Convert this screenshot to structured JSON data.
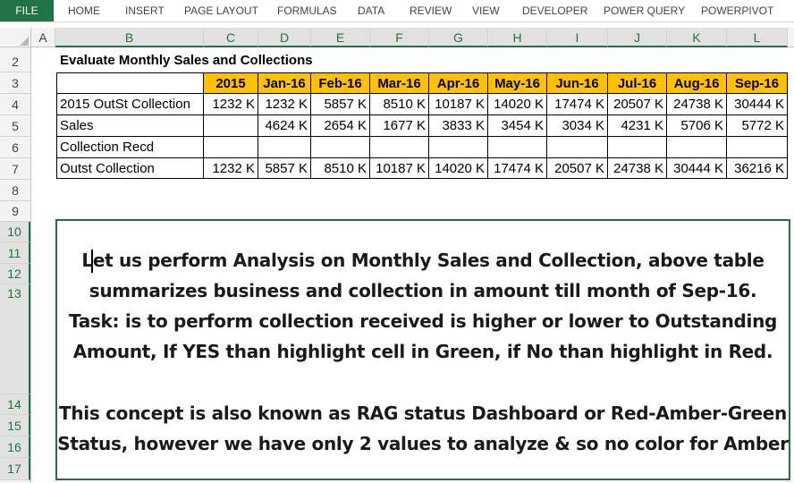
{
  "ribbon": {
    "tabs": [
      "FILE",
      "HOME",
      "INSERT",
      "PAGE LAYOUT",
      "FORMULAS",
      "DATA",
      "REVIEW",
      "VIEW",
      "DEVELOPER",
      "POWER QUERY",
      "POWERPIVOT"
    ]
  },
  "columns": [
    "A",
    "B",
    "C",
    "D",
    "E",
    "F",
    "G",
    "H",
    "I",
    "J",
    "K",
    "L"
  ],
  "rows": [
    "2",
    "3",
    "4",
    "5",
    "6",
    "7",
    "8",
    "9",
    "10",
    "11",
    "12",
    "13",
    "14",
    "15",
    "16",
    "17"
  ],
  "sheet": {
    "title": "Evaluate Monthly Sales and Collections",
    "headers": [
      "2015",
      "Jan-16",
      "Feb-16",
      "Mar-16",
      "Apr-16",
      "May-16",
      "Jun-16",
      "Jul-16",
      "Aug-16",
      "Sep-16"
    ],
    "table": [
      {
        "label": "2015 OutSt Collection",
        "values": [
          "1232 K",
          "1232 K",
          "5857 K",
          "8510 K",
          "10187 K",
          "14020 K",
          "17474 K",
          "20507 K",
          "24738 K",
          "30444 K"
        ]
      },
      {
        "label": "Sales",
        "values": [
          "",
          "4624 K",
          "2654 K",
          "1677 K",
          "3833 K",
          "3454 K",
          "3034 K",
          "4231 K",
          "5706 K",
          "5772 K"
        ]
      },
      {
        "label": "Collection Recd",
        "values": [
          "",
          "",
          "",
          "",
          "",
          "",
          "",
          "",
          "",
          ""
        ]
      },
      {
        "label": "Outst Collection",
        "values": [
          "1232 K",
          "5857 K",
          "8510 K",
          "10187 K",
          "14020 K",
          "17474 K",
          "20507 K",
          "24738 K",
          "30444 K",
          "36216 K"
        ]
      }
    ]
  },
  "textbox": {
    "lines": [
      "Let us perform Analysis on Monthly Sales and Collection, above table",
      "summarizes business and collection in amount till month of Sep-16.",
      "Task: is to perform collection received is higher or lower to Outstanding",
      "Amount, If YES than highlight cell in Green, if No than highlight in Red.",
      "",
      "This concept is also known as RAG status Dashboard or Red-Amber-Green",
      "Status, however we have only 2 values to analyze & so no color for Amber"
    ]
  },
  "colors": {
    "file_tab": "#217346",
    "header_fill": "#ffc000",
    "textbox_border": "#2e6b43"
  }
}
